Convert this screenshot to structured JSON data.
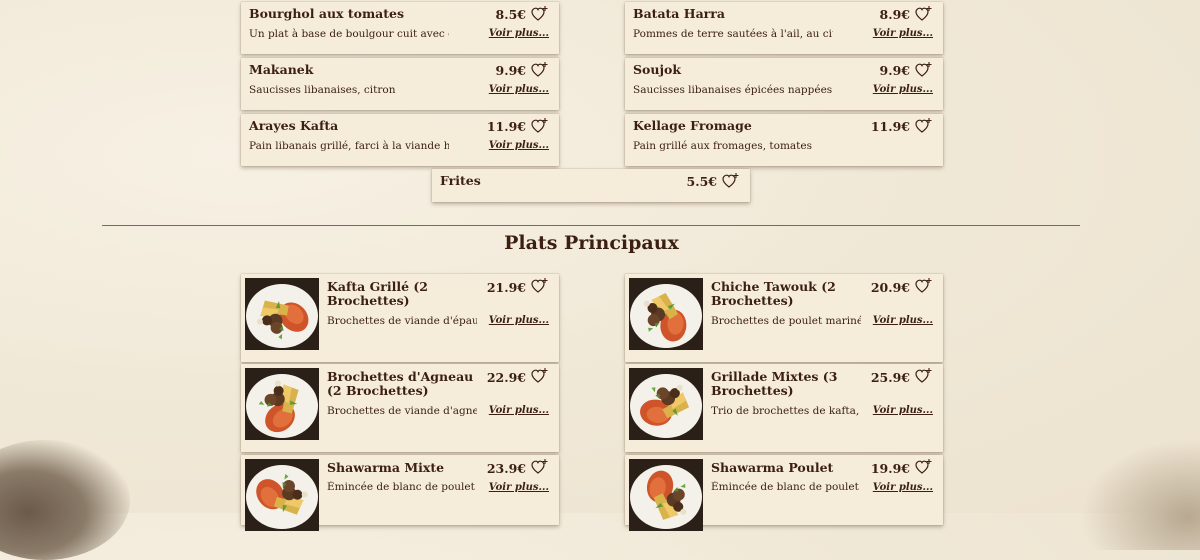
{
  "small_items": [
    {
      "name": "Bourghol aux tomates",
      "price": "8.5€",
      "desc": "Un plat à base de boulgour cuit avec des t...",
      "more": "Voir plus..."
    },
    {
      "name": "Batata Harra",
      "price": "8.9€",
      "desc": "Pommes de terre sautées à l'ail, au citron ...",
      "more": "Voir plus..."
    },
    {
      "name": "Makanek",
      "price": "9.9€",
      "desc": "Saucisses libanaises, citron",
      "more": "Voir plus..."
    },
    {
      "name": "Soujok",
      "price": "9.9€",
      "desc": "Saucisses libanaises épicées nappées de ju...",
      "more": "Voir plus..."
    },
    {
      "name": "Arayes Kafta",
      "price": "11.9€",
      "desc": "Pain libanais grillé, farci à la viande haché...",
      "more": "Voir plus..."
    },
    {
      "name": "Kellage Fromage",
      "price": "11.9€",
      "desc": "Pain grillé aux fromages, tomates",
      "more": ""
    },
    {
      "name": "Frites",
      "price": "5.5€",
      "desc": "",
      "more": ""
    }
  ],
  "section_title": "Plats Principaux",
  "main_items": [
    {
      "name": "Kafta Grillé (2 Brochettes)",
      "price": "21.9€",
      "desc": "Brochettes de viande d'épaule ...",
      "more": "Voir plus..."
    },
    {
      "name": "Chiche Tawouk (2 Brochettes)",
      "price": "20.9€",
      "desc": "Brochettes de poulet mariné a...",
      "more": "Voir plus..."
    },
    {
      "name": "Brochettes d'Agneau (2 Brochettes)",
      "price": "22.9€",
      "desc": "Brochettes de viande d'agneau...",
      "more": "Voir plus..."
    },
    {
      "name": "Grillade Mixtes (3 Brochettes)",
      "price": "25.9€",
      "desc": "Trio de brochettes de kafta, chi...",
      "more": "Voir plus..."
    },
    {
      "name": "Shawarma Mixte",
      "price": "23.9€",
      "desc": "Émincée de blanc de poulet et ...",
      "more": "Voir plus..."
    },
    {
      "name": "Shawarma Poulet",
      "price": "19.9€",
      "desc": "Émincée de blanc de poulet m...",
      "more": "Voir plus..."
    }
  ],
  "icons": {
    "favorite": "heart-plus-icon"
  }
}
